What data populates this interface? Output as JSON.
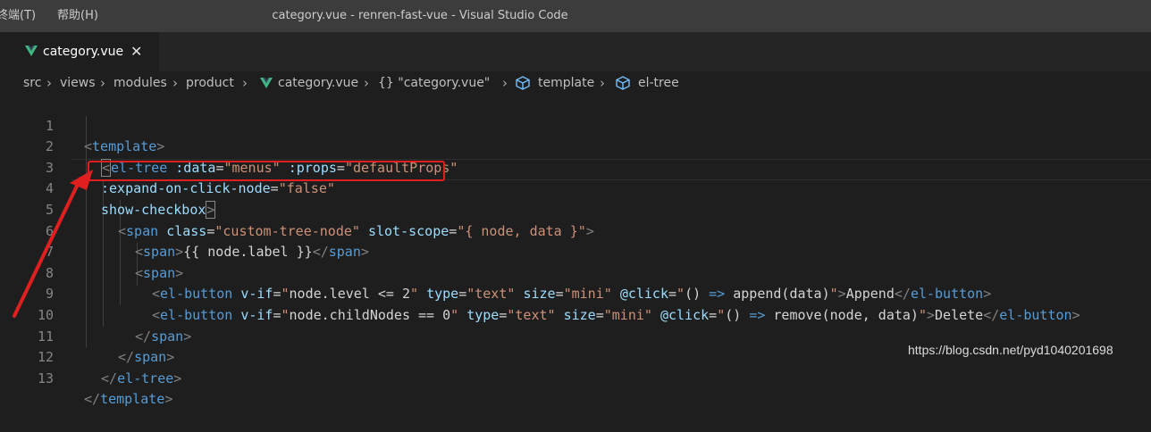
{
  "titlebar": {
    "menus": [
      "终端(T)",
      "帮助(H)"
    ],
    "title": "category.vue - renren-fast-vue - Visual Studio Code"
  },
  "tab": {
    "label": "category.vue",
    "close": "✕",
    "icon": "vue-icon"
  },
  "breadcrumb": {
    "items": [
      "src",
      "views",
      "modules",
      "product",
      "category.vue",
      "{} \"category.vue\"",
      "template",
      "el-tree"
    ]
  },
  "editor": {
    "line_numbers": [
      "1",
      "2",
      "3",
      "4",
      "5",
      "6",
      "7",
      "8",
      "9",
      "10",
      "11",
      "12",
      "13"
    ],
    "lines": [
      "<template>",
      "  <el-tree :data=\"menus\" :props=\"defaultProps\"",
      "  :expand-on-click-node=\"false\"",
      "  show-checkbox>",
      "    <span class=\"custom-tree-node\" slot-scope=\"{ node, data }\">",
      "      <span>{{ node.label }}</span>",
      "      <span>",
      "        <el-button v-if=\"node.level <= 2\" type=\"text\" size=\"mini\" @click=\"() => append(data)\">Append</el-button>",
      "        <el-button v-if=\"node.childNodes == 0\" type=\"text\" size=\"mini\" @click=\"() => remove(node, data)\">Delete</el-button>",
      "      </span>",
      "    </span>",
      "  </el-tree>",
      "</template>"
    ]
  },
  "watermark": "https://blog.csdn.net/pyd1040201698",
  "colors": {
    "tag": "#569cd6",
    "attribute": "#9cdcfe",
    "string": "#ce9178",
    "annotation": "#e02020"
  }
}
